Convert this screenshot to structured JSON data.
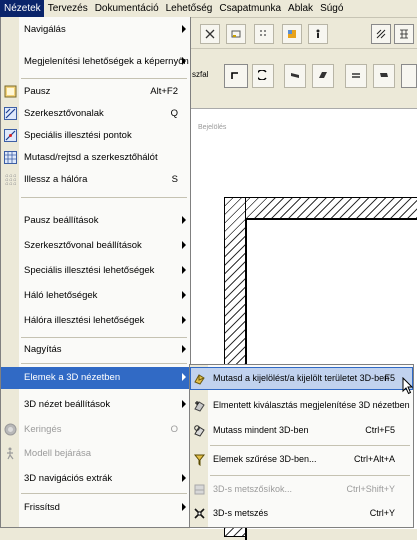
{
  "menubar": {
    "items": [
      "Nézetek",
      "Tervezés",
      "Dokumentáció",
      "Lehetőség",
      "Csapatmunka",
      "Ablak",
      "Súgó"
    ]
  },
  "toolbar": {
    "left_label": "szfal"
  },
  "canvas": {
    "label": "Bejelölés"
  },
  "menu": {
    "items": [
      {
        "label": "Navigálás",
        "submenu": true,
        "icon": ""
      },
      {
        "label": "Megjelenítési lehetőségek a képernyőn",
        "submenu": true,
        "icon": ""
      },
      {
        "label": "Pausz",
        "shortcut": "Alt+F2",
        "icon": "tracing-icon"
      },
      {
        "label": "Szerkesztővonalak",
        "shortcut": "Q",
        "icon": "guide-lines-icon"
      },
      {
        "label": "Speciális illesztési pontok",
        "icon": "special-snap-icon"
      },
      {
        "label": "Mutasd/rejtsd a szerkesztőhálót",
        "icon": "grid-icon"
      },
      {
        "label": "Illessz a hálóra",
        "shortcut": "S",
        "icon": "snap-grid-icon"
      },
      {
        "label": "Pausz beállítások",
        "submenu": true
      },
      {
        "label": "Szerkesztővonal beállítások",
        "submenu": true
      },
      {
        "label": "Speciális illesztési lehetőségek",
        "submenu": true
      },
      {
        "label": "Háló lehetőségek",
        "submenu": true
      },
      {
        "label": "Hálóra illesztési lehetőségek",
        "submenu": true
      },
      {
        "label": "Nagyítás",
        "submenu": true
      },
      {
        "label": "Elemek a 3D nézetben",
        "submenu": true
      },
      {
        "label": "3D nézet beállítások",
        "submenu": true
      },
      {
        "label": "Keringés",
        "shortcut": "O",
        "icon": "orbit-icon",
        "disabled": true
      },
      {
        "label": "Modell bejárása",
        "icon": "walk-icon",
        "disabled": true
      },
      {
        "label": "3D navigációs extrák",
        "submenu": true
      },
      {
        "label": "Frissítsd",
        "submenu": true
      }
    ]
  },
  "submenu": {
    "items": [
      {
        "label": "Mutasd a kijelölést/a kijelölt területet 3D-ben",
        "shortcut": "F5",
        "icon": "show-selection-3d-icon"
      },
      {
        "label": "Elmentett kiválasztás megjelenítése 3D nézetben",
        "icon": "saved-selection-icon"
      },
      {
        "label": "Mutass mindent 3D-ben",
        "shortcut": "Ctrl+F5",
        "icon": "show-all-3d-icon"
      },
      {
        "label": "Elemek szűrése 3D-ben...",
        "shortcut": "Ctrl+Alt+A",
        "icon": "filter-elements-icon"
      },
      {
        "label": "3D-s metszősíkok...",
        "shortcut": "Ctrl+Shift+Y",
        "icon": "cutting-planes-icon",
        "disabled": true
      },
      {
        "label": "3D-s metszés",
        "shortcut": "Ctrl+Y",
        "icon": "3d-cutaway-icon"
      }
    ]
  },
  "colors": {
    "highlight": "#316ac5",
    "submenu_highlight": "#c1d2ee",
    "menubar_active": "#0a246a"
  }
}
